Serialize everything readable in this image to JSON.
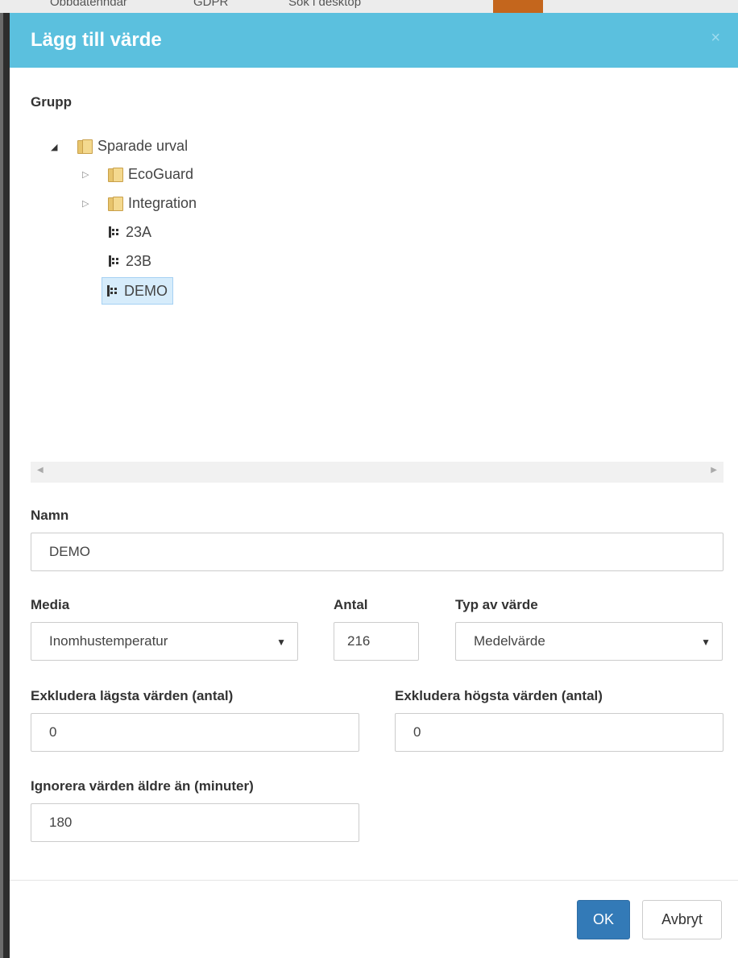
{
  "background": {
    "peek_1": "Obbdatenndar",
    "peek_2": "GDPR",
    "peek_3": "Sök i desktop"
  },
  "dialog": {
    "title": "Lägg till värde",
    "close_glyph": "×"
  },
  "group": {
    "label": "Grupp",
    "tree": {
      "root": {
        "label": "Sparade urval",
        "expanded": true
      },
      "children": [
        {
          "label": "EcoGuard",
          "kind": "folder",
          "collapsed": true
        },
        {
          "label": "Integration",
          "kind": "folder",
          "collapsed": true
        },
        {
          "label": "23A",
          "kind": "building"
        },
        {
          "label": "23B",
          "kind": "building"
        },
        {
          "label": "DEMO",
          "kind": "building",
          "selected": true
        }
      ]
    }
  },
  "name_field": {
    "label": "Namn",
    "value": "DEMO"
  },
  "media_field": {
    "label": "Media",
    "value": "Inomhustemperatur"
  },
  "count_field": {
    "label": "Antal",
    "value": "216"
  },
  "value_type_field": {
    "label": "Typ av värde",
    "value": "Medelvärde"
  },
  "exclude_lowest_field": {
    "label": "Exkludera lägsta värden (antal)",
    "value": "0"
  },
  "exclude_highest_field": {
    "label": "Exkludera högsta värden (antal)",
    "value": "0"
  },
  "ignore_older_field": {
    "label": "Ignorera värden äldre än (minuter)",
    "value": "180"
  },
  "buttons": {
    "ok": "OK",
    "cancel": "Avbryt"
  },
  "colors": {
    "header": "#5bc0de",
    "primary_button": "#337ab7",
    "selection": "#d6ecfb"
  }
}
